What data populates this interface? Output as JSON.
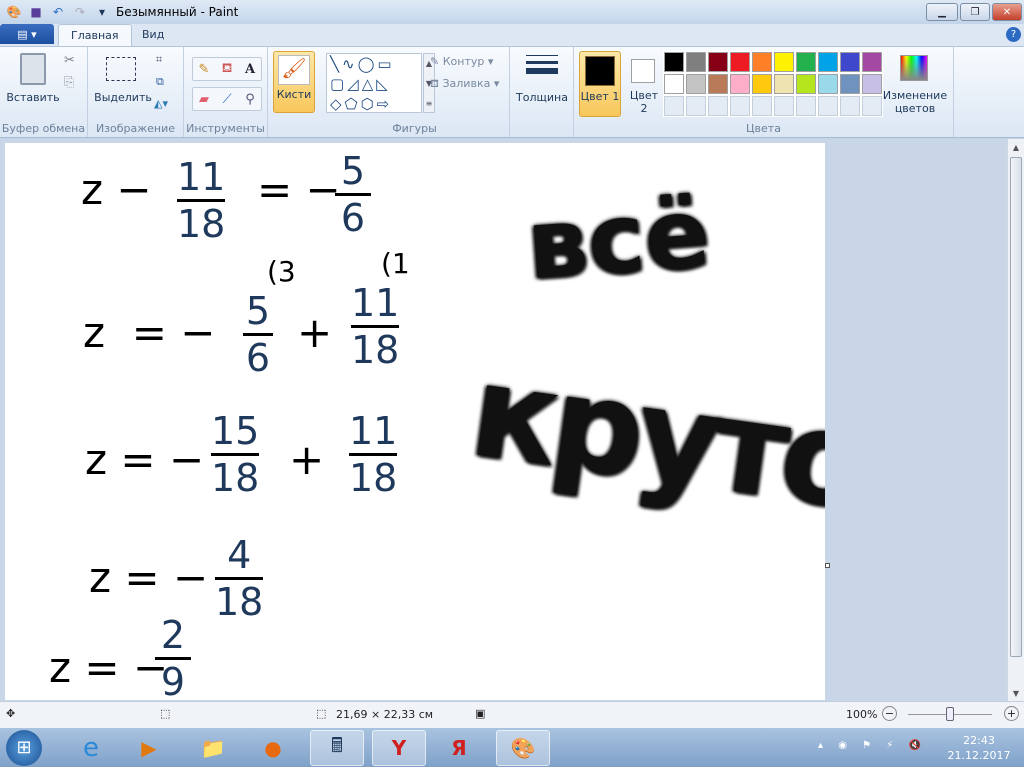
{
  "window": {
    "title": "Безымянный - Paint"
  },
  "tabs": {
    "file": "▤ ▾",
    "home": "Главная",
    "view": "Вид"
  },
  "ribbon": {
    "clipboard": {
      "paste": "Вставить",
      "label": "Буфер обмена"
    },
    "image": {
      "select": "Выделить",
      "label": "Изображение"
    },
    "tools": {
      "label": "Инструменты"
    },
    "brushes": {
      "label": "Кисти"
    },
    "shapes": {
      "outline": "Контур",
      "fill": "Заливка",
      "label": "Фигуры"
    },
    "size": {
      "label": "Толщина"
    },
    "colors": {
      "color1": "Цвет 1",
      "color2": "Цвет 2",
      "edit": "Изменение цветов",
      "label": "Цвета",
      "color1_value": "#000000",
      "color2_value": "#ffffff",
      "palette": [
        "#000000",
        "#7f7f7f",
        "#880015",
        "#ed1c24",
        "#ff7f27",
        "#fff200",
        "#22b14c",
        "#00a2e8",
        "#3f48cc",
        "#a349a4",
        "#ffffff",
        "#c3c3c3",
        "#b97a57",
        "#ffaec9",
        "#ffc90e",
        "#efe4b0",
        "#b5e61d",
        "#99d9ea",
        "#7092be",
        "#c8bfe7"
      ]
    }
  },
  "drawing": {
    "l1": {
      "z": "z −",
      "n1": "11",
      "d1": "18",
      "eq": "= −",
      "n2": "5",
      "d2": "6"
    },
    "l2": {
      "z": "z  = −",
      "n1": "5",
      "d1": "6",
      "s1": "(3",
      "plus": "+",
      "n2": "11",
      "d2": "18",
      "s2": "(1"
    },
    "l3": {
      "z": "z = −",
      "n1": "15",
      "d1": "18",
      "plus": "+",
      "n2": "11",
      "d2": "18"
    },
    "l4": {
      "z": "z = −",
      "n1": "4",
      "d1": "18"
    },
    "l5": {
      "z": "z = −",
      "n1": "2",
      "d1": "9"
    },
    "text1": "всё",
    "text2": "круто"
  },
  "status": {
    "canvas_size": "21,69 × 22,33 см",
    "zoom": "100%",
    "zoom_fraction": 0.5
  },
  "taskbar": {
    "time": "22:43",
    "date": "21.12.2017"
  }
}
